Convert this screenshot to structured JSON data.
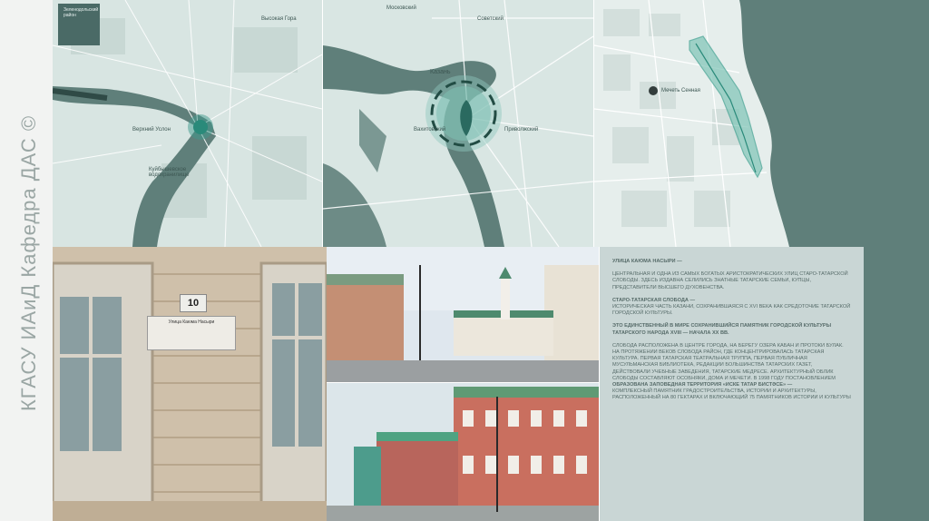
{
  "side_label": "КГАСУ ИАиД Кафедра ДАС ©",
  "maps": {
    "region": {
      "labels": [
        "Верхний Услон",
        "Куйбышевское водохранилище",
        "Высокая Гора"
      ],
      "inset": "Зеленодольский район"
    },
    "city": {
      "labels": [
        "Казань",
        "Московский",
        "Советский",
        "Вахитовский",
        "Приволжский"
      ]
    },
    "district": {
      "labels": [
        "Мечеть Сенная"
      ]
    }
  },
  "photo": {
    "house_number": "10",
    "plaque_title": "Улица Каюма Насыри"
  },
  "text": {
    "p1_head": "Улица Каюма Насыри —",
    "p1": "центральная и одна из самых богатых аристократических улиц Старо-Татарской слободы. Здесь издавна селились знатные татарские семьи, купцы, представители высшего духовенства.",
    "p2_head": "Старо-Татарская слобода —",
    "p2": "историческая часть Казани, сохранившаяся с XVI века как средоточие татарской городской культуры.",
    "p3": "Это единственный в мире сохранившийся памятник городской культуры татарского народа XVIII — начала XX вв.",
    "p4": "Слобода расположена в центре города, на берегу озера Кабан и протоки Булак. На протяжении веков слобода район, где концентрировалась татарская культура. Первая татарская театральная труппа, первая публичная мусульманская библиотека, редакции большинства татарских газет, действовали учебные заведения, татарские медресе. Архитектурный облик слободы составляют особняки, дома и мечети. В 1998 году постановлением",
    "p5_head": "образована заповедная территория «Иске Татар бистәсе» —",
    "p5": "комплексный памятник градостроительства, истории и архитектуры, расположенный на 80 гектарах и включающий 75 памятников истории и культуры"
  }
}
